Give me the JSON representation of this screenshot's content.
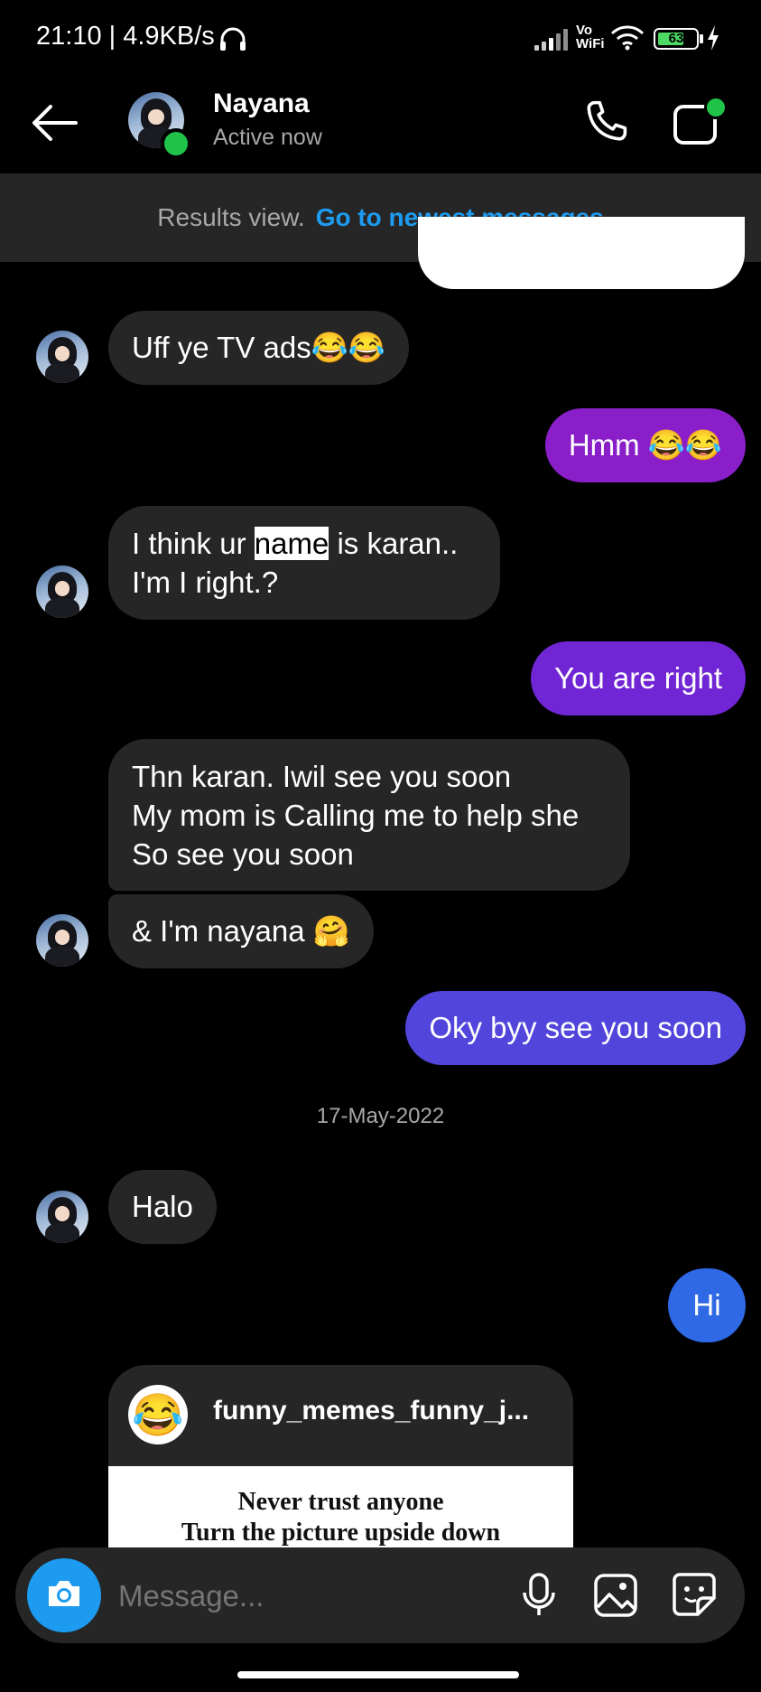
{
  "status_bar": {
    "time": "21:10 | 4.9KB/s",
    "network_label_top": "Vo",
    "network_label_bottom": "WiFi",
    "battery": "63"
  },
  "header": {
    "contact_name": "Nayana",
    "status": "Active now"
  },
  "results_bar": {
    "text": "Results view.",
    "link": "Go to newest messages"
  },
  "messages": [
    {
      "from": "them",
      "lines": [
        "Uff ye TV ads😂😂"
      ]
    },
    {
      "from": "me",
      "lines": [
        "Hmm 😂😂"
      ]
    },
    {
      "from": "them",
      "line1_before": "I think ur ",
      "line1_highlight": "name",
      "line1_after": " is karan..",
      "line2": "I'm I right.?"
    },
    {
      "from": "me",
      "lines": [
        "You are right"
      ]
    },
    {
      "from": "them",
      "lines": [
        "Thn karan. Iwil see you soon",
        "My mom is Calling me to help she",
        "So see you soon"
      ]
    },
    {
      "from": "them",
      "lines": [
        "& I'm nayana 🤗"
      ]
    },
    {
      "from": "me",
      "lines": [
        "Oky byy see you soon"
      ]
    },
    {
      "from": "them",
      "lines": [
        "Halo"
      ]
    },
    {
      "from": "me",
      "lines": [
        "Hi"
      ]
    }
  ],
  "date_separator": "17-May-2022",
  "shared_post": {
    "account": "funny_memes_funny_j...",
    "image_line1": "Never trust anyone",
    "image_line2": "Turn the picture upside down"
  },
  "composer": {
    "placeholder": "Message..."
  },
  "colors": {
    "incoming_bubble": "#262626",
    "outgoing_purple_1": "#8a1fc9",
    "outgoing_purple_2": "#7126d6",
    "outgoing_indigo": "#5245dc",
    "outgoing_blue": "#2f69e6",
    "link_blue": "#1d9bf0",
    "online_green": "#1fc34a",
    "camera_blue": "#1d9bf0"
  }
}
